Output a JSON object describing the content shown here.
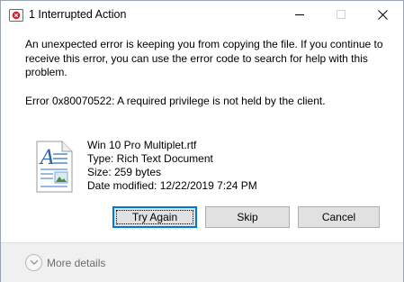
{
  "window": {
    "title": "1 Interrupted Action"
  },
  "message": {
    "body": "An unexpected error is keeping you from copying the file. If you continue to receive this error, you can use the error code to search for help with this problem.",
    "error": "Error 0x80070522: A required privilege is not held by the client."
  },
  "file": {
    "name": "Win 10 Pro Multiplet.rtf",
    "type": "Type: Rich Text Document",
    "size": "Size: 259 bytes",
    "modified": "Date modified: 12/22/2019 7:24 PM",
    "icon": "rtf-document-icon"
  },
  "buttons": {
    "try_again": "Try Again",
    "skip": "Skip",
    "cancel": "Cancel"
  },
  "footer": {
    "more_details": "More details"
  },
  "colors": {
    "accent": "#0078d7",
    "button_bg": "#e1e1e1",
    "footer_bg": "#f0f0f0",
    "error_icon": "#e81123"
  }
}
